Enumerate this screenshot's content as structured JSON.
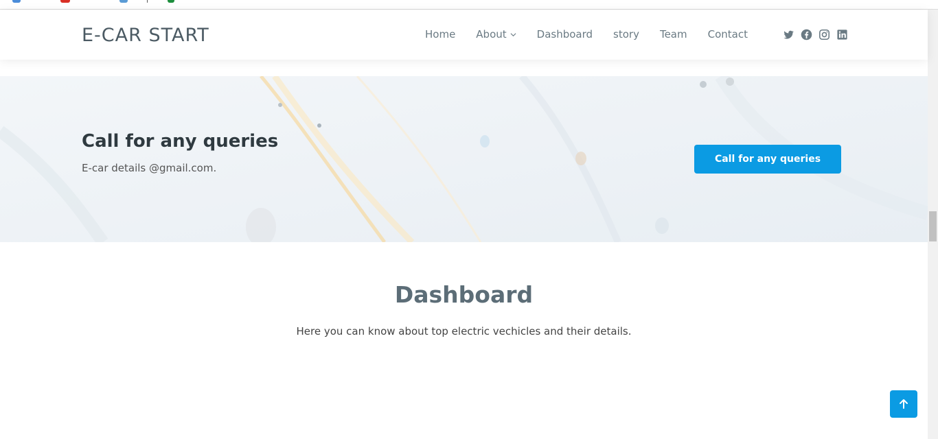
{
  "header": {
    "logo": "E-CAR START",
    "nav": [
      "Home",
      "About",
      "Dashboard",
      "story",
      "Team",
      "Contact"
    ],
    "socials": [
      "twitter-icon",
      "facebook-icon",
      "instagram-icon",
      "linkedin-icon"
    ]
  },
  "cta": {
    "title": "Call for any queries",
    "subtitle": "E-car details @gmail.com.",
    "button": "Call for any queries"
  },
  "dashboard": {
    "title": "Dashboard",
    "subtitle": "Here you can know about top electric vechicles and their details."
  },
  "colors": {
    "accent": "#0b9be3",
    "logo": "#4b5a63",
    "nav_text": "#6a7a83"
  },
  "icons": {
    "back_to_top": "arrow-up-icon",
    "about_dropdown": "chevron-down-icon"
  }
}
